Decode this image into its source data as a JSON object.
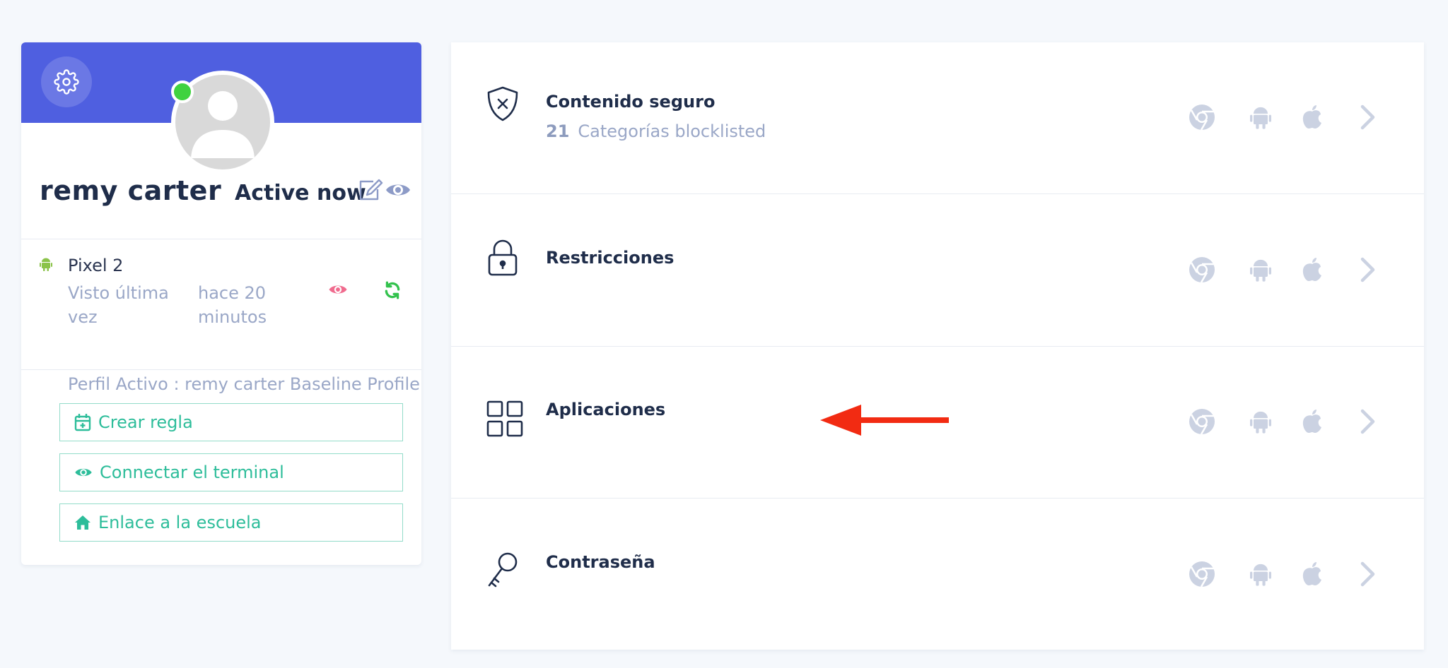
{
  "profile": {
    "name": "remy carter",
    "status": "Active now",
    "device": {
      "name": "Pixel 2",
      "last_seen_label": "Visto última vez",
      "last_seen_value": "hace 20 minutos",
      "active_profile": "Perfil Activo : remy carter Baseline Profile"
    },
    "actions": [
      {
        "label": "Crear regla",
        "icon": "calendar-plus-icon"
      },
      {
        "label": "Connectar el terminal",
        "icon": "eye-icon"
      },
      {
        "label": "Enlace a la escuela",
        "icon": "home-icon"
      }
    ]
  },
  "settings": [
    {
      "title": "Contenido seguro",
      "count": "21",
      "subtitle": "Categorías blocklisted",
      "icon": "shield-x-icon"
    },
    {
      "title": "Restricciones",
      "icon": "lock-icon"
    },
    {
      "title": "Aplicaciones",
      "icon": "grid-icon"
    },
    {
      "title": "Contraseña",
      "icon": "key-icon"
    }
  ],
  "platform_icons": [
    "chrome-icon",
    "android-icon",
    "apple-icon",
    "chevron-right-icon"
  ],
  "colors": {
    "banner": "#4f5fe0",
    "accent_green": "#2dbd9a",
    "online": "#3fd23f",
    "view_pink": "#f06b8e",
    "sync_green": "#33c24d",
    "arrow_red": "#f22b12",
    "muted": "#9aa7c7"
  }
}
